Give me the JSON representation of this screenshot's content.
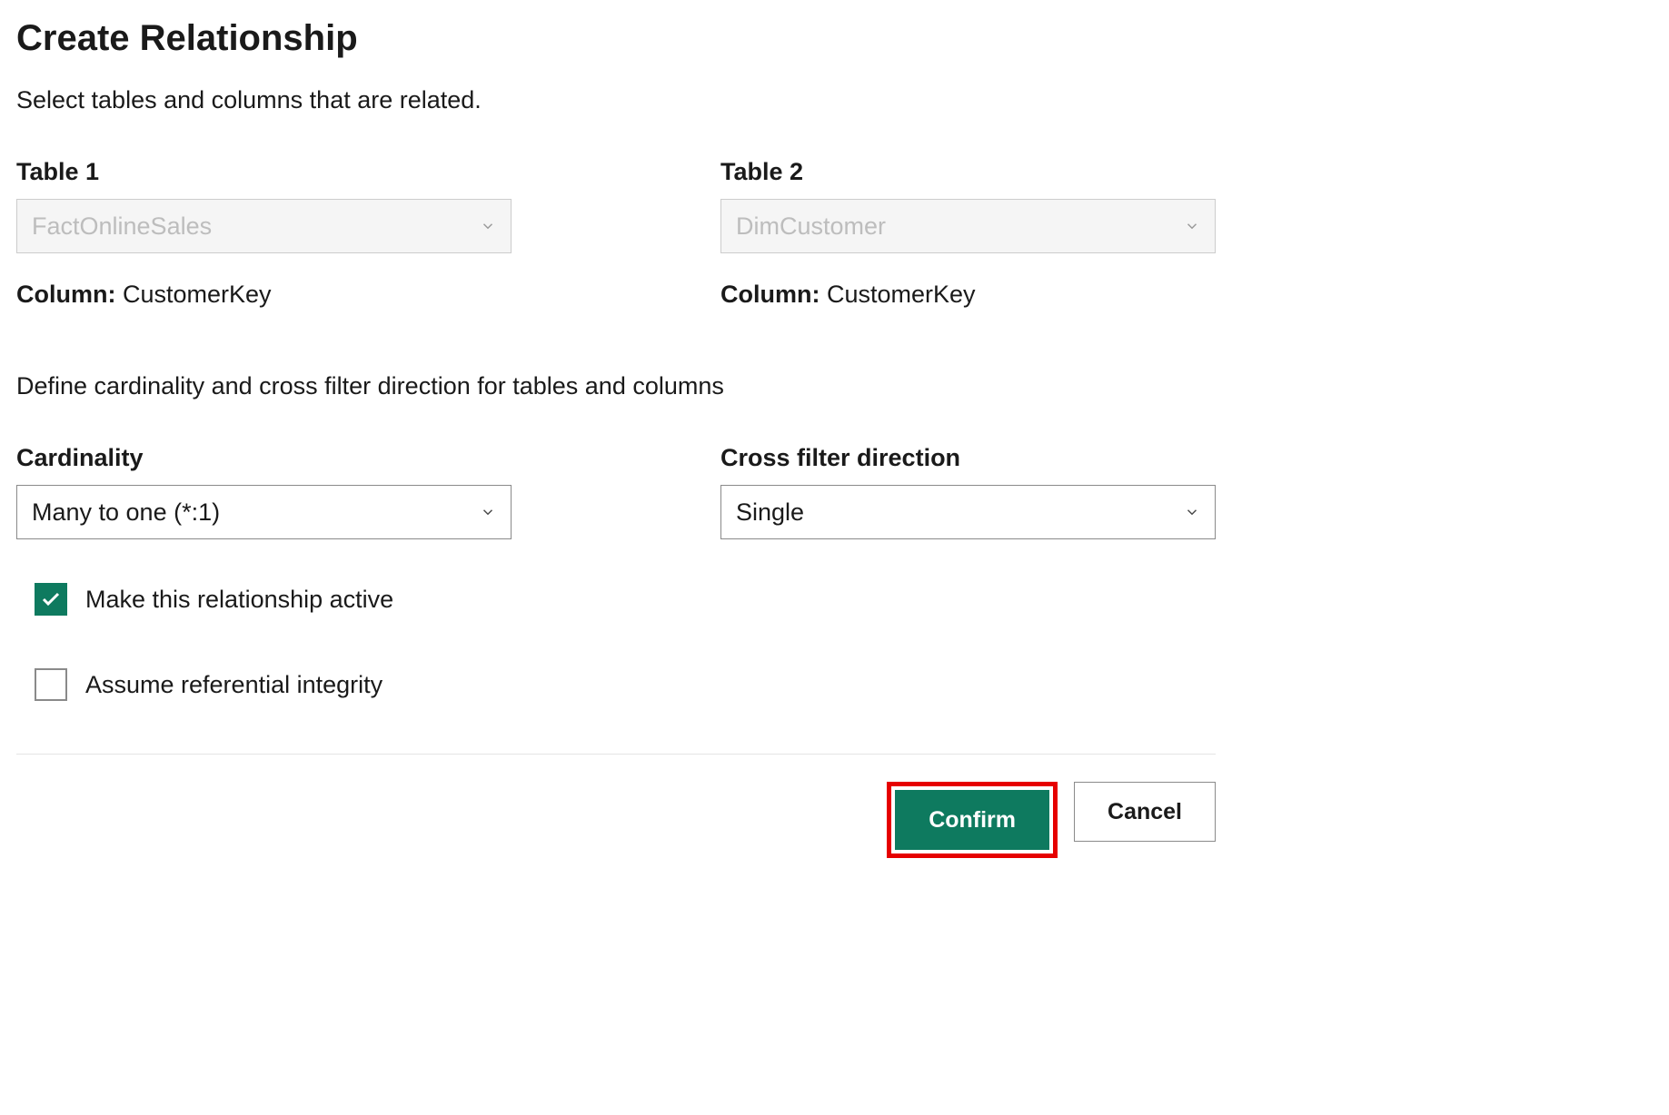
{
  "dialog": {
    "title": "Create Relationship",
    "subtitle": "Select tables and columns that are related."
  },
  "table1": {
    "label": "Table 1",
    "selected": "FactOnlineSales",
    "columnLabel": "Column:",
    "columnValue": "CustomerKey"
  },
  "table2": {
    "label": "Table 2",
    "selected": "DimCustomer",
    "columnLabel": "Column:",
    "columnValue": "CustomerKey"
  },
  "section2": {
    "subtitle": "Define cardinality and cross filter direction for tables and columns"
  },
  "cardinality": {
    "label": "Cardinality",
    "value": "Many to one (*:1)"
  },
  "crossFilter": {
    "label": "Cross filter direction",
    "value": "Single"
  },
  "checkboxes": {
    "active": {
      "label": "Make this relationship active",
      "checked": true
    },
    "referential": {
      "label": "Assume referential integrity",
      "checked": false
    }
  },
  "buttons": {
    "confirm": "Confirm",
    "cancel": "Cancel"
  },
  "colors": {
    "primary": "#0e7a5f",
    "highlight": "#e60000"
  }
}
